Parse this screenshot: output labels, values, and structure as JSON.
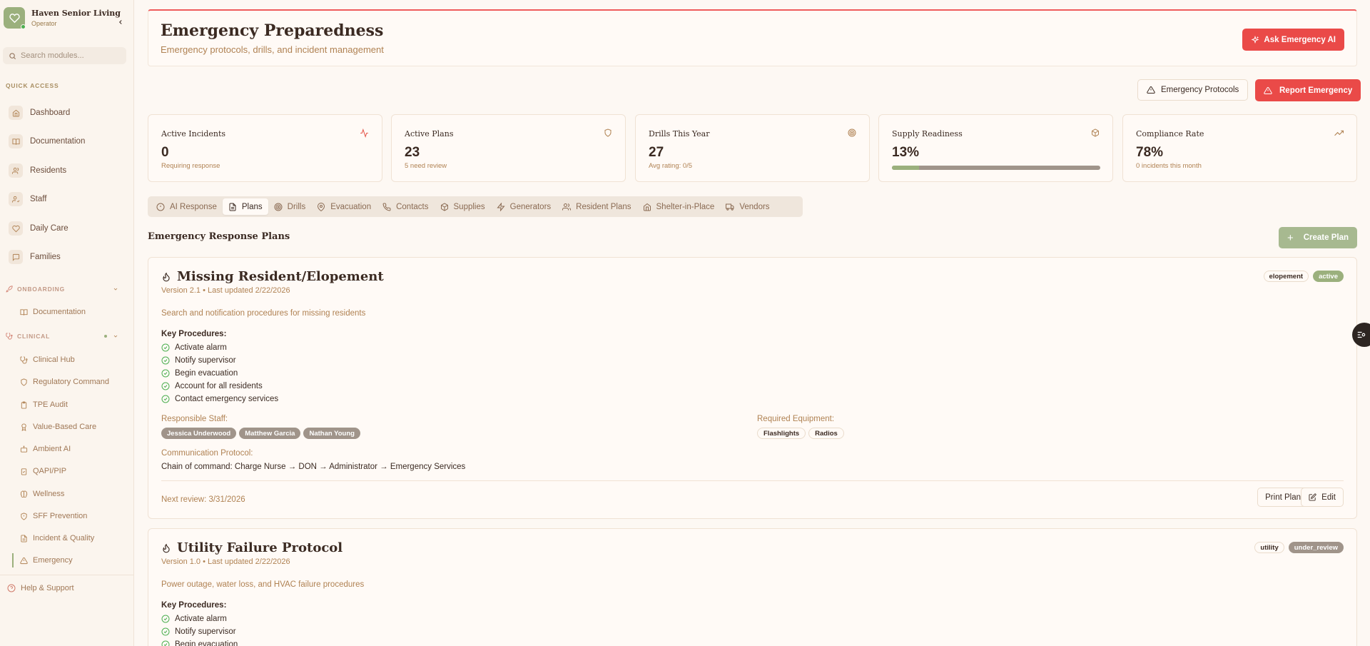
{
  "sidebar": {
    "brand_name": "Haven Senior Living",
    "brand_role": "Operator",
    "search_placeholder": "Search modules...",
    "quick_access_label": "QUICK ACCESS",
    "quick_items": [
      {
        "label": "Dashboard",
        "icon": "home-icon"
      },
      {
        "label": "Documentation",
        "icon": "book-icon"
      },
      {
        "label": "Residents",
        "icon": "users-icon"
      },
      {
        "label": "Staff",
        "icon": "user-check-icon"
      },
      {
        "label": "Daily Care",
        "icon": "heart-icon"
      },
      {
        "label": "Families",
        "icon": "message-icon"
      }
    ],
    "onboarding_label": "ONBOARDING",
    "onboarding_items": [
      {
        "label": "Documentation",
        "icon": "book-icon"
      }
    ],
    "clinical_label": "CLINICAL",
    "clinical_items": [
      {
        "label": "Clinical Hub",
        "icon": "stethoscope-icon"
      },
      {
        "label": "Regulatory Command",
        "icon": "shield-icon"
      },
      {
        "label": "TPE Audit",
        "icon": "clipboard-icon"
      },
      {
        "label": "Value-Based Care",
        "icon": "award-icon"
      },
      {
        "label": "Ambient AI",
        "icon": "bot-icon"
      },
      {
        "label": "QAPI/PIP",
        "icon": "clipboard-check-icon"
      },
      {
        "label": "Wellness",
        "icon": "brain-icon"
      },
      {
        "label": "SFF Prevention",
        "icon": "shield-alert-icon"
      },
      {
        "label": "Incident & Quality",
        "icon": "file-icon"
      },
      {
        "label": "Emergency",
        "icon": "alert-triangle-icon"
      }
    ],
    "help_label": "Help & Support"
  },
  "header": {
    "title": "Emergency Preparedness",
    "subtitle": "Emergency protocols, drills, and incident management",
    "ask_ai_label": "Ask Emergency AI"
  },
  "actions": {
    "protocols_label": "Emergency Protocols",
    "report_label": "Report Emergency"
  },
  "stats": [
    {
      "label": "Active Incidents",
      "value": "0",
      "sub": "Requiring response",
      "icon": "activity-icon"
    },
    {
      "label": "Active Plans",
      "value": "23",
      "sub": "5 need review",
      "icon": "shield-icon"
    },
    {
      "label": "Drills This Year",
      "value": "27",
      "sub": "Avg rating: 0/5",
      "icon": "target-icon"
    },
    {
      "label": "Supply Readiness",
      "value": "13%",
      "progress": 0.13,
      "icon": "package-icon"
    },
    {
      "label": "Compliance Rate",
      "value": "78%",
      "sub": "0 incidents this month",
      "icon": "trending-up-icon"
    }
  ],
  "tabs": [
    {
      "label": "AI Response",
      "icon": "alert-circle-icon"
    },
    {
      "label": "Plans",
      "icon": "file-text-icon",
      "active": true
    },
    {
      "label": "Drills",
      "icon": "target-icon"
    },
    {
      "label": "Evacuation",
      "icon": "map-pin-icon"
    },
    {
      "label": "Contacts",
      "icon": "phone-icon"
    },
    {
      "label": "Supplies",
      "icon": "package-icon"
    },
    {
      "label": "Generators",
      "icon": "zap-icon"
    },
    {
      "label": "Resident Plans",
      "icon": "users-icon"
    },
    {
      "label": "Shelter-in-Place",
      "icon": "home-icon"
    },
    {
      "label": "Vendors",
      "icon": "truck-icon"
    }
  ],
  "plans_section": {
    "title": "Emergency Response Plans",
    "create_label": "Create Plan"
  },
  "plans": [
    {
      "title": "Missing Resident/Elopement",
      "version": "Version 2.1 • Last updated 2/22/2026",
      "tags": [
        "elopement",
        "active"
      ],
      "description": "Search and notification procedures for missing residents",
      "key_procedures_label": "Key Procedures:",
      "procedures": [
        "Activate alarm",
        "Notify supervisor",
        "Begin evacuation",
        "Account for all residents",
        "Contact emergency services"
      ],
      "responsible_label": "Responsible Staff:",
      "staff": [
        "Jessica Underwood",
        "Matthew Garcia",
        "Nathan Young"
      ],
      "equipment_label": "Required Equipment:",
      "equipment": [
        "Flashlights",
        "Radios"
      ],
      "comm_label": "Communication Protocol:",
      "comm": "Chain of command: Charge Nurse → DON → Administrator → Emergency Services",
      "next_review": "Next review: 3/31/2026",
      "print_label": "Print Plan",
      "edit_label": "Edit"
    },
    {
      "title": "Utility Failure Protocol",
      "version": "Version 1.0 • Last updated 2/22/2026",
      "tags": [
        "utility",
        "under_review"
      ],
      "description": "Power outage, water loss, and HVAC failure procedures",
      "key_procedures_label": "Key Procedures:",
      "procedures": [
        "Activate alarm",
        "Notify supervisor",
        "Begin evacuation"
      ]
    }
  ],
  "colors": {
    "accent_red": "#ea4a48",
    "brand_green": "#9bb07d",
    "staff_pill": "#a0948a",
    "text_brown": "#b08253"
  }
}
